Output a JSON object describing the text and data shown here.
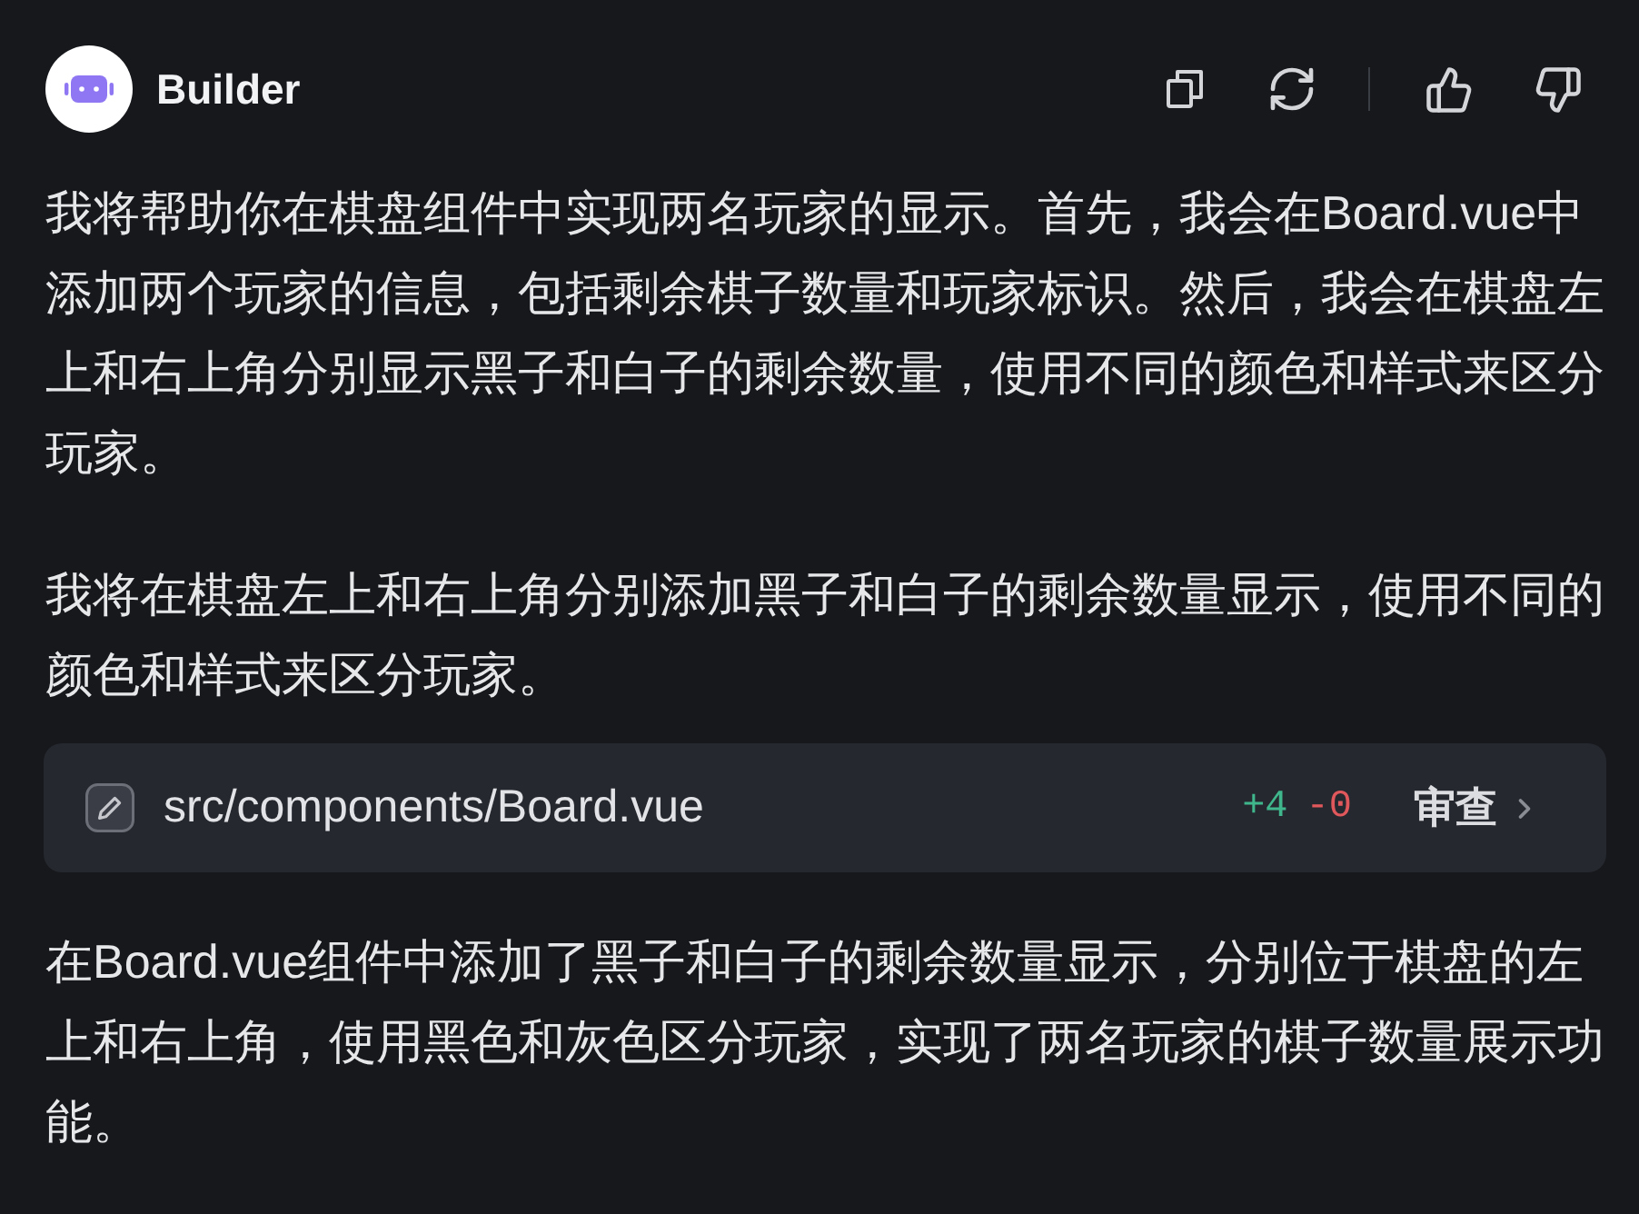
{
  "header": {
    "name": "Builder"
  },
  "content": [
    {
      "kind": "paragraph",
      "text": "我将帮助你在棋盘组件中实现两名玩家的显示。首先，我会在Board.vue中添加两个玩家的信息，包括剩余棋子数量和玩家标识。然后，我会在棋盘左上和右上角分别显示黑子和白子的剩余数量，使用不同的颜色和样式来区分玩家。"
    },
    {
      "kind": "paragraph",
      "text": "我将在棋盘左上和右上角分别添加黑子和白子的剩余数量显示，使用不同的颜色和样式来区分玩家。"
    },
    {
      "kind": "file_change",
      "path": "src/components/Board.vue",
      "additions": "+4",
      "deletions": "-0",
      "action": "审查"
    },
    {
      "kind": "paragraph",
      "text": "在Board.vue组件中添加了黑子和白子的剩余数量显示，分别位于棋盘的左上和右上角，使用黑色和灰色区分玩家，实现了两名玩家的棋子数量展示功能。"
    }
  ]
}
